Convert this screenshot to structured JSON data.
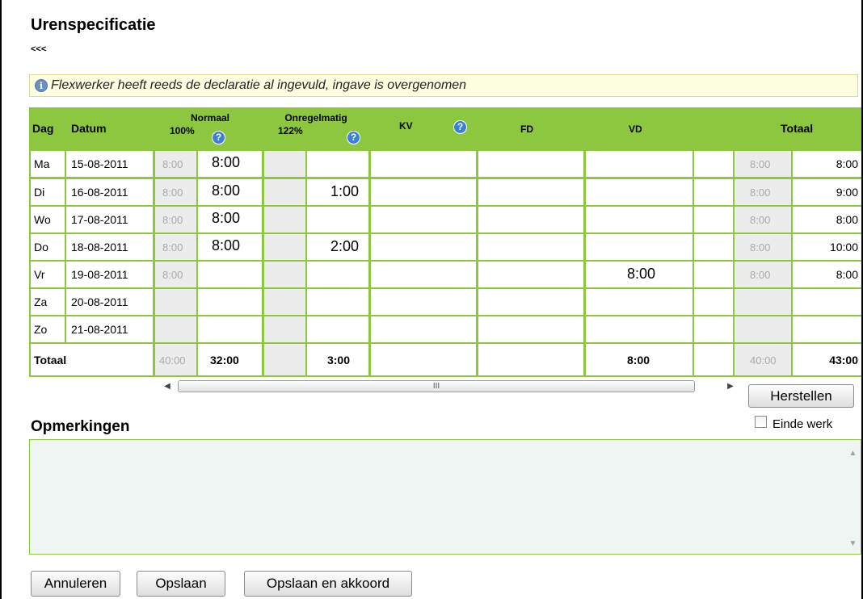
{
  "page": {
    "title": "Urenspecificatie",
    "back_link": "<<<",
    "info_message": "Flexwerker heeft reeds de declaratie al ingevuld, ingave is overgenomen",
    "info_icon": "info-icon"
  },
  "table": {
    "headers": {
      "dag": "Dag",
      "datum": "Datum",
      "normaal": "Normaal",
      "normaal_pct": "100%",
      "onregelmatig": "Onregelmatig",
      "onregelmatig_pct": "122%",
      "kv": "KV",
      "fd": "FD",
      "vd": "VD",
      "totaal": "Totaal",
      "help_glyph": "?"
    },
    "rows": [
      {
        "dag": "Ma",
        "datum": "15-08-2011",
        "normaal_plan": "8:00",
        "normaal": "8:00",
        "onregelmatig": "",
        "vd": "",
        "totaal_plan": "8:00",
        "totaal": "8:00"
      },
      {
        "dag": "Di",
        "datum": "16-08-2011",
        "normaal_plan": "8:00",
        "normaal": "8:00",
        "onregelmatig": "1:00",
        "vd": "",
        "totaal_plan": "8:00",
        "totaal": "9:00"
      },
      {
        "dag": "Wo",
        "datum": "17-08-2011",
        "normaal_plan": "8:00",
        "normaal": "8:00",
        "onregelmatig": "",
        "vd": "",
        "totaal_plan": "8:00",
        "totaal": "8:00"
      },
      {
        "dag": "Do",
        "datum": "18-08-2011",
        "normaal_plan": "8:00",
        "normaal": "8:00",
        "onregelmatig": "2:00",
        "vd": "",
        "totaal_plan": "8:00",
        "totaal": "10:00"
      },
      {
        "dag": "Vr",
        "datum": "19-08-2011",
        "normaal_plan": "8:00",
        "normaal": "",
        "onregelmatig": "",
        "vd": "8:00",
        "totaal_plan": "8:00",
        "totaal": "8:00"
      },
      {
        "dag": "Za",
        "datum": "20-08-2011",
        "normaal_plan": "",
        "normaal": "",
        "onregelmatig": "",
        "vd": "",
        "totaal_plan": "",
        "totaal": ""
      },
      {
        "dag": "Zo",
        "datum": "21-08-2011",
        "normaal_plan": "",
        "normaal": "",
        "onregelmatig": "",
        "vd": "",
        "totaal_plan": "",
        "totaal": ""
      }
    ],
    "totals": {
      "label": "Totaal",
      "normaal_plan": "40:00",
      "normaal": "32:00",
      "onregelmatig": "3:00",
      "vd": "8:00",
      "totaal_plan": "40:00",
      "totaal": "43:00"
    },
    "scrollbar": {
      "left_arrow": "◀",
      "right_arrow": "▶",
      "thumb_grip": "III"
    }
  },
  "buttons": {
    "herstellen": "Herstellen",
    "annuleren": "Annuleren",
    "opslaan": "Opslaan",
    "opslaan_akkoord": "Opslaan en akkoord"
  },
  "remarks": {
    "title": "Opmerkingen",
    "einde_werk_label": "Einde werk",
    "einde_werk_checked": false,
    "value": "",
    "scroll_up": "▲",
    "scroll_down": "▼"
  },
  "colors": {
    "accent_green": "#8dc63f",
    "info_background": "#fefee0",
    "help_blue": "#3c7fd8"
  }
}
